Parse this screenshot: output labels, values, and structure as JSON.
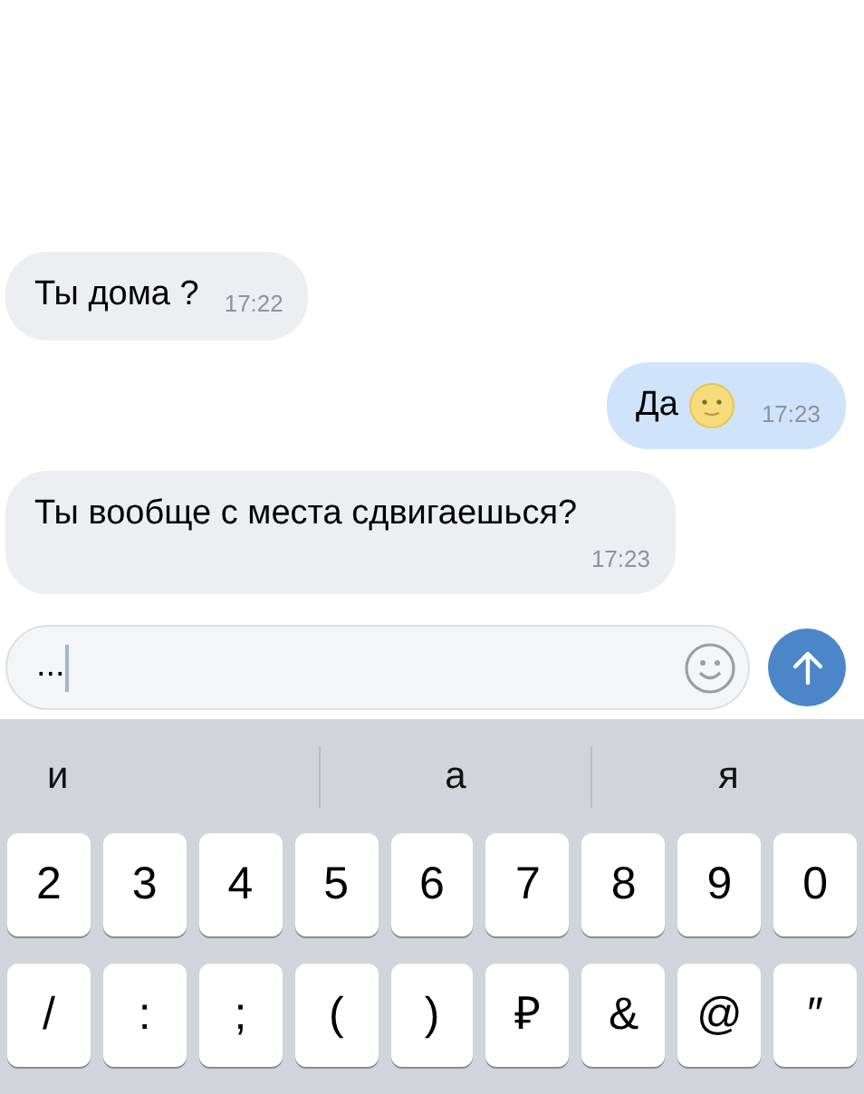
{
  "messages": [
    {
      "kind": "incoming",
      "text": "Ты дома ?",
      "time": "17:22",
      "emoji": false
    },
    {
      "kind": "outgoing",
      "text": "Да",
      "time": "17:23",
      "emoji": true
    },
    {
      "kind": "incoming",
      "text": "Ты вообще с места сдвигаешься?",
      "time": "17:23",
      "emoji": false
    }
  ],
  "composer": {
    "value": "...",
    "cursor": true
  },
  "suggestions": [
    "и",
    "а",
    "я"
  ],
  "keyboard_rows": [
    [
      "2",
      "3",
      "4",
      "5",
      "6",
      "7",
      "8",
      "9",
      "0"
    ],
    [
      "/",
      ":",
      ";",
      "(",
      ")",
      "₽",
      "&",
      "@",
      "″"
    ]
  ]
}
